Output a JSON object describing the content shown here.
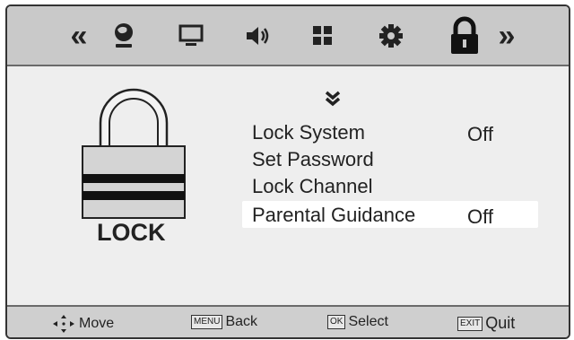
{
  "top_nav": {
    "left_arrow": "«",
    "right_arrow": "»",
    "icons": [
      "picture-icon",
      "screen-icon",
      "speaker-icon",
      "grid-icon",
      "gear-icon",
      "padlock-icon"
    ]
  },
  "panel": {
    "lock_label": "LOCK"
  },
  "menu": {
    "items": [
      {
        "label": "Lock System",
        "value": "Off"
      },
      {
        "label": "Set Password",
        "value": ""
      },
      {
        "label": "Lock Channel",
        "value": ""
      },
      {
        "label": "Parental Guidance",
        "value": "Off"
      }
    ],
    "selected_index": 3
  },
  "footer": {
    "move_label": "Move",
    "menu_key": "MENU",
    "back_label": "Back",
    "ok_key": "OK",
    "select_label": "Select",
    "exit_key": "EXIT",
    "quit_label": "Quit"
  }
}
